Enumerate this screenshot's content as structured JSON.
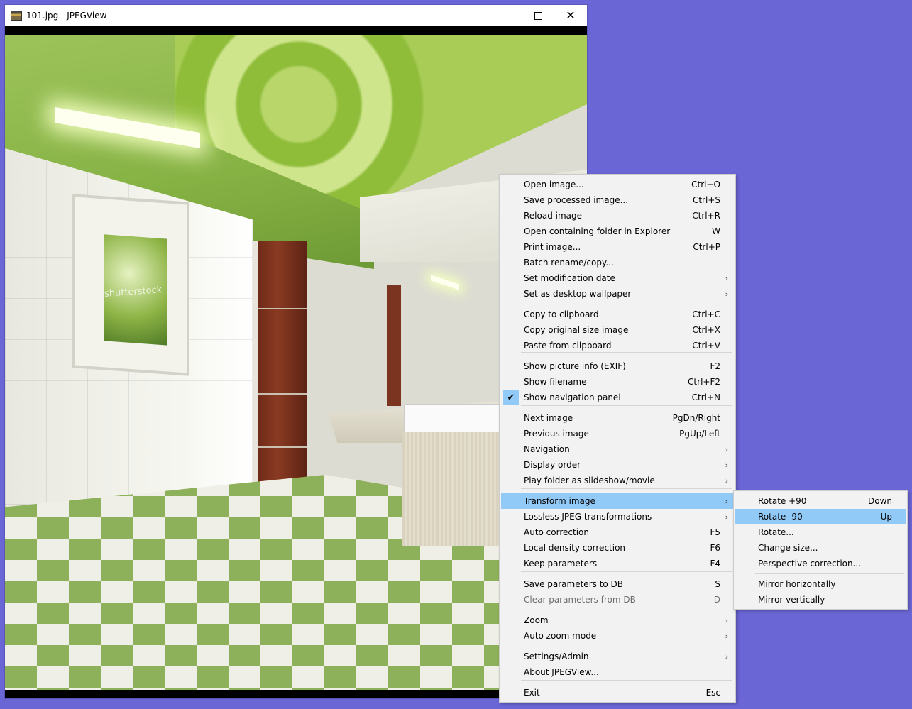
{
  "window": {
    "title": "101.jpg - JPEGView",
    "controls": {
      "minimize": "minimize-icon",
      "maximize": "maximize-icon",
      "close": "close-icon"
    }
  },
  "image": {
    "watermark": "shutterstock"
  },
  "menu": {
    "items": [
      {
        "label": "Open image...",
        "shortcut": "Ctrl+O"
      },
      {
        "label": "Save processed image...",
        "shortcut": "Ctrl+S"
      },
      {
        "label": "Reload image",
        "shortcut": "Ctrl+R"
      },
      {
        "label": "Open containing folder in Explorer",
        "shortcut": "W"
      },
      {
        "label": "Print image...",
        "shortcut": "Ctrl+P"
      },
      {
        "label": "Batch rename/copy...",
        "shortcut": ""
      },
      {
        "label": "Set modification date",
        "shortcut": ""
      },
      {
        "label": "Set as desktop wallpaper",
        "shortcut": ""
      },
      {
        "label": "Copy to clipboard",
        "shortcut": "Ctrl+C"
      },
      {
        "label": "Copy original size image",
        "shortcut": "Ctrl+X"
      },
      {
        "label": "Paste from clipboard",
        "shortcut": "Ctrl+V"
      },
      {
        "label": "Show picture info (EXIF)",
        "shortcut": "F2"
      },
      {
        "label": "Show filename",
        "shortcut": "Ctrl+F2"
      },
      {
        "label": "Show navigation panel",
        "shortcut": "Ctrl+N",
        "checked": true
      },
      {
        "label": "Next image",
        "shortcut": "PgDn/Right"
      },
      {
        "label": "Previous image",
        "shortcut": "PgUp/Left"
      },
      {
        "label": "Navigation",
        "shortcut": ""
      },
      {
        "label": "Display order",
        "shortcut": ""
      },
      {
        "label": "Play folder as slideshow/movie",
        "shortcut": ""
      },
      {
        "label": "Transform image",
        "shortcut": "",
        "highlighted": true
      },
      {
        "label": "Lossless JPEG transformations",
        "shortcut": ""
      },
      {
        "label": "Auto correction",
        "shortcut": "F5"
      },
      {
        "label": "Local density correction",
        "shortcut": "F6"
      },
      {
        "label": "Keep parameters",
        "shortcut": "F4"
      },
      {
        "label": "Save parameters to DB",
        "shortcut": "S"
      },
      {
        "label": "Clear parameters from DB",
        "shortcut": "D",
        "disabled": true
      },
      {
        "label": "Zoom",
        "shortcut": ""
      },
      {
        "label": "Auto zoom mode",
        "shortcut": ""
      },
      {
        "label": "Settings/Admin",
        "shortcut": ""
      },
      {
        "label": "About JPEGView...",
        "shortcut": ""
      },
      {
        "label": "Exit",
        "shortcut": "Esc"
      }
    ],
    "submenu_arrow": "›"
  },
  "submenu": {
    "items": [
      {
        "label": "Rotate +90",
        "shortcut": "Down"
      },
      {
        "label": "Rotate -90",
        "shortcut": "Up",
        "highlighted": true
      },
      {
        "label": "Rotate...",
        "shortcut": ""
      },
      {
        "label": "Change size...",
        "shortcut": ""
      },
      {
        "label": "Perspective correction...",
        "shortcut": ""
      },
      {
        "label": "Mirror horizontally",
        "shortcut": ""
      },
      {
        "label": "Mirror vertically",
        "shortcut": ""
      }
    ]
  },
  "colors": {
    "desktop": "#6b66d6",
    "menu_bg": "#f2f2f2",
    "highlight": "#91c9f7"
  }
}
